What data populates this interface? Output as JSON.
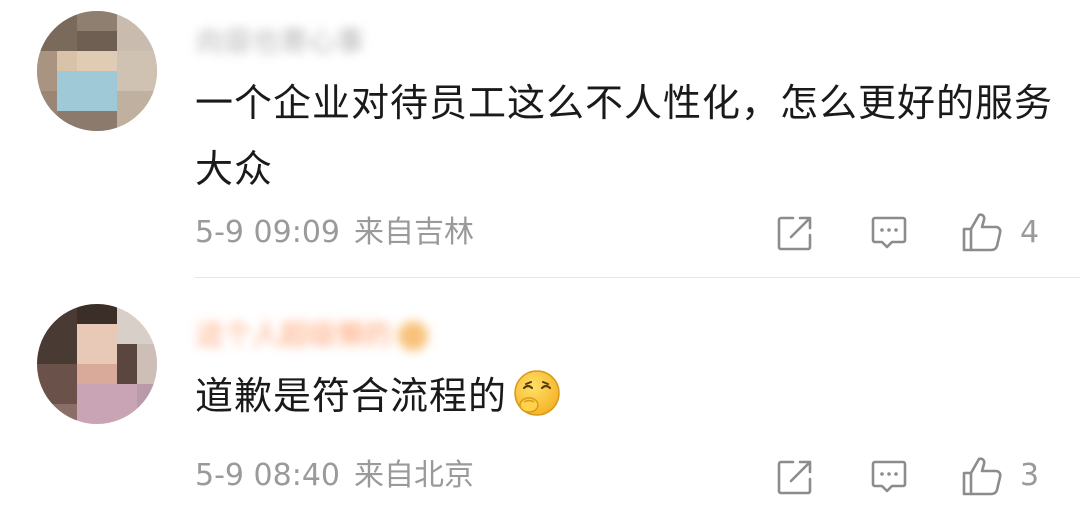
{
  "comments": [
    {
      "username": "向容也寄心事",
      "text": "一个企业对待员工这么不人性化，怎么更好的服务大众",
      "emoji": "",
      "time": "5-9 09:09",
      "location": "来自吉林",
      "likes": "4",
      "icons": {
        "share": "share-icon",
        "comment": "comment-icon",
        "like": "thumbs-up-icon"
      }
    },
    {
      "username": "这个人超级懒的",
      "text": "道歉是符合流程的",
      "emoji": "snickering-emoji",
      "time": "5-9 08:40",
      "location": "来自北京",
      "likes": "3",
      "icons": {
        "share": "share-icon",
        "comment": "comment-icon",
        "like": "thumbs-up-icon"
      }
    }
  ],
  "colors": {
    "text": "#1a1a1a",
    "meta": "#9a9a9a",
    "divider": "#e6e6e6",
    "vip_username": "#ff8a50"
  }
}
